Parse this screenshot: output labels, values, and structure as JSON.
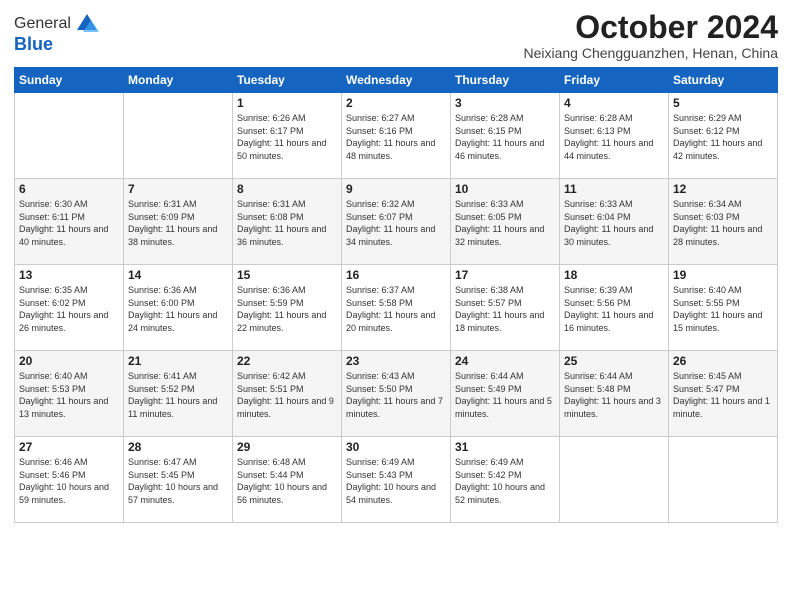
{
  "header": {
    "logo": {
      "general": "General",
      "blue": "Blue"
    },
    "title": "October 2024",
    "location": "Neixiang Chengguanzhen, Henan, China"
  },
  "days_of_week": [
    "Sunday",
    "Monday",
    "Tuesday",
    "Wednesday",
    "Thursday",
    "Friday",
    "Saturday"
  ],
  "weeks": [
    [
      {
        "day": "",
        "sunrise": "",
        "sunset": "",
        "daylight": ""
      },
      {
        "day": "",
        "sunrise": "",
        "sunset": "",
        "daylight": ""
      },
      {
        "day": "1",
        "sunrise": "Sunrise: 6:26 AM",
        "sunset": "Sunset: 6:17 PM",
        "daylight": "Daylight: 11 hours and 50 minutes."
      },
      {
        "day": "2",
        "sunrise": "Sunrise: 6:27 AM",
        "sunset": "Sunset: 6:16 PM",
        "daylight": "Daylight: 11 hours and 48 minutes."
      },
      {
        "day": "3",
        "sunrise": "Sunrise: 6:28 AM",
        "sunset": "Sunset: 6:15 PM",
        "daylight": "Daylight: 11 hours and 46 minutes."
      },
      {
        "day": "4",
        "sunrise": "Sunrise: 6:28 AM",
        "sunset": "Sunset: 6:13 PM",
        "daylight": "Daylight: 11 hours and 44 minutes."
      },
      {
        "day": "5",
        "sunrise": "Sunrise: 6:29 AM",
        "sunset": "Sunset: 6:12 PM",
        "daylight": "Daylight: 11 hours and 42 minutes."
      }
    ],
    [
      {
        "day": "6",
        "sunrise": "Sunrise: 6:30 AM",
        "sunset": "Sunset: 6:11 PM",
        "daylight": "Daylight: 11 hours and 40 minutes."
      },
      {
        "day": "7",
        "sunrise": "Sunrise: 6:31 AM",
        "sunset": "Sunset: 6:09 PM",
        "daylight": "Daylight: 11 hours and 38 minutes."
      },
      {
        "day": "8",
        "sunrise": "Sunrise: 6:31 AM",
        "sunset": "Sunset: 6:08 PM",
        "daylight": "Daylight: 11 hours and 36 minutes."
      },
      {
        "day": "9",
        "sunrise": "Sunrise: 6:32 AM",
        "sunset": "Sunset: 6:07 PM",
        "daylight": "Daylight: 11 hours and 34 minutes."
      },
      {
        "day": "10",
        "sunrise": "Sunrise: 6:33 AM",
        "sunset": "Sunset: 6:05 PM",
        "daylight": "Daylight: 11 hours and 32 minutes."
      },
      {
        "day": "11",
        "sunrise": "Sunrise: 6:33 AM",
        "sunset": "Sunset: 6:04 PM",
        "daylight": "Daylight: 11 hours and 30 minutes."
      },
      {
        "day": "12",
        "sunrise": "Sunrise: 6:34 AM",
        "sunset": "Sunset: 6:03 PM",
        "daylight": "Daylight: 11 hours and 28 minutes."
      }
    ],
    [
      {
        "day": "13",
        "sunrise": "Sunrise: 6:35 AM",
        "sunset": "Sunset: 6:02 PM",
        "daylight": "Daylight: 11 hours and 26 minutes."
      },
      {
        "day": "14",
        "sunrise": "Sunrise: 6:36 AM",
        "sunset": "Sunset: 6:00 PM",
        "daylight": "Daylight: 11 hours and 24 minutes."
      },
      {
        "day": "15",
        "sunrise": "Sunrise: 6:36 AM",
        "sunset": "Sunset: 5:59 PM",
        "daylight": "Daylight: 11 hours and 22 minutes."
      },
      {
        "day": "16",
        "sunrise": "Sunrise: 6:37 AM",
        "sunset": "Sunset: 5:58 PM",
        "daylight": "Daylight: 11 hours and 20 minutes."
      },
      {
        "day": "17",
        "sunrise": "Sunrise: 6:38 AM",
        "sunset": "Sunset: 5:57 PM",
        "daylight": "Daylight: 11 hours and 18 minutes."
      },
      {
        "day": "18",
        "sunrise": "Sunrise: 6:39 AM",
        "sunset": "Sunset: 5:56 PM",
        "daylight": "Daylight: 11 hours and 16 minutes."
      },
      {
        "day": "19",
        "sunrise": "Sunrise: 6:40 AM",
        "sunset": "Sunset: 5:55 PM",
        "daylight": "Daylight: 11 hours and 15 minutes."
      }
    ],
    [
      {
        "day": "20",
        "sunrise": "Sunrise: 6:40 AM",
        "sunset": "Sunset: 5:53 PM",
        "daylight": "Daylight: 11 hours and 13 minutes."
      },
      {
        "day": "21",
        "sunrise": "Sunrise: 6:41 AM",
        "sunset": "Sunset: 5:52 PM",
        "daylight": "Daylight: 11 hours and 11 minutes."
      },
      {
        "day": "22",
        "sunrise": "Sunrise: 6:42 AM",
        "sunset": "Sunset: 5:51 PM",
        "daylight": "Daylight: 11 hours and 9 minutes."
      },
      {
        "day": "23",
        "sunrise": "Sunrise: 6:43 AM",
        "sunset": "Sunset: 5:50 PM",
        "daylight": "Daylight: 11 hours and 7 minutes."
      },
      {
        "day": "24",
        "sunrise": "Sunrise: 6:44 AM",
        "sunset": "Sunset: 5:49 PM",
        "daylight": "Daylight: 11 hours and 5 minutes."
      },
      {
        "day": "25",
        "sunrise": "Sunrise: 6:44 AM",
        "sunset": "Sunset: 5:48 PM",
        "daylight": "Daylight: 11 hours and 3 minutes."
      },
      {
        "day": "26",
        "sunrise": "Sunrise: 6:45 AM",
        "sunset": "Sunset: 5:47 PM",
        "daylight": "Daylight: 11 hours and 1 minute."
      }
    ],
    [
      {
        "day": "27",
        "sunrise": "Sunrise: 6:46 AM",
        "sunset": "Sunset: 5:46 PM",
        "daylight": "Daylight: 10 hours and 59 minutes."
      },
      {
        "day": "28",
        "sunrise": "Sunrise: 6:47 AM",
        "sunset": "Sunset: 5:45 PM",
        "daylight": "Daylight: 10 hours and 57 minutes."
      },
      {
        "day": "29",
        "sunrise": "Sunrise: 6:48 AM",
        "sunset": "Sunset: 5:44 PM",
        "daylight": "Daylight: 10 hours and 56 minutes."
      },
      {
        "day": "30",
        "sunrise": "Sunrise: 6:49 AM",
        "sunset": "Sunset: 5:43 PM",
        "daylight": "Daylight: 10 hours and 54 minutes."
      },
      {
        "day": "31",
        "sunrise": "Sunrise: 6:49 AM",
        "sunset": "Sunset: 5:42 PM",
        "daylight": "Daylight: 10 hours and 52 minutes."
      },
      {
        "day": "",
        "sunrise": "",
        "sunset": "",
        "daylight": ""
      },
      {
        "day": "",
        "sunrise": "",
        "sunset": "",
        "daylight": ""
      }
    ]
  ]
}
